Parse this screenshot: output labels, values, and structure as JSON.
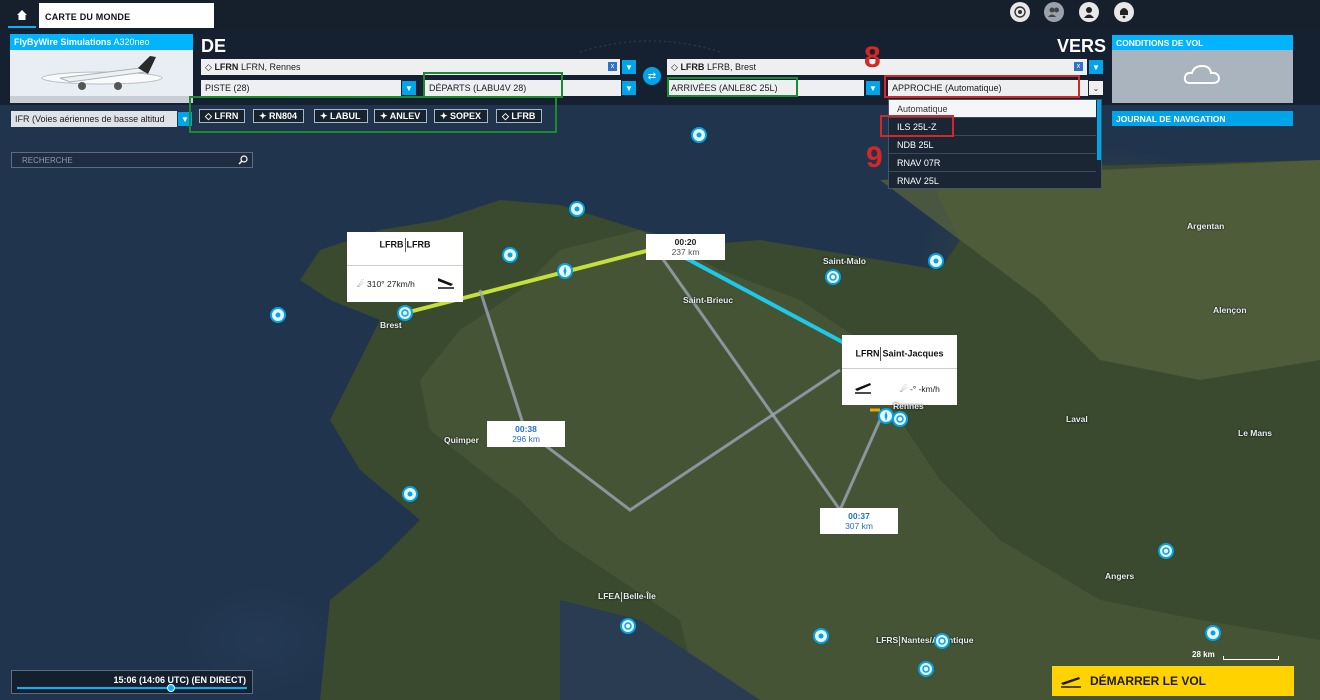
{
  "topbar": {
    "home_icon": "home-icon",
    "world_tab": "CARTE DU MONDE",
    "icons": [
      "radar-icon",
      "friends-icon",
      "profile-icon",
      "notification-icon"
    ]
  },
  "aircraft": {
    "brand": "FlyByWire Simulations",
    "model": "A320neo"
  },
  "from": {
    "label": "DE",
    "airport_code": "LFRN",
    "airport_name": "LFRN, Rennes",
    "runway": "PISTE (28)",
    "departure": "DÉPARTS (LABU4V 28)"
  },
  "to": {
    "label": "VERS",
    "airport_code": "LFRB",
    "airport_name": "LFRB, Brest",
    "arrival": "ARRIVÉES (ANLE8C 25L)",
    "approach": "APPROCHE (Automatique)"
  },
  "weather": {
    "title": "CONDITIONS DE VOL",
    "icon": "cloud-icon"
  },
  "nav_log": {
    "title": "JOURNAL DE NAVIGATION"
  },
  "flight_type": "IFR (Voies aériennes de basse altitud",
  "waypoints": [
    "LFRN",
    "RN804",
    "LABUL",
    "ANLEV",
    "SOPEX",
    "LFRB"
  ],
  "approach_options": [
    "Automatique",
    "ILS 25L-Z",
    "NDB 25L",
    "RNAV 07R",
    "RNAV 25L"
  ],
  "annotations": {
    "step8": "8",
    "step9": "9"
  },
  "search": {
    "placeholder": "RECHERCHE"
  },
  "info_boxes": {
    "brest": {
      "code": "LFRB",
      "name": "LFRB",
      "wind": "310° 27km/h"
    },
    "rennes": {
      "code": "LFRN",
      "name": "Saint-Jacques",
      "wind": "-° -km/h"
    }
  },
  "legs": [
    {
      "time": "00:20",
      "distance": "237 km"
    },
    {
      "time": "00:38",
      "distance": "296 km"
    },
    {
      "time": "00:37",
      "distance": "307 km"
    }
  ],
  "cities": {
    "brest": "Brest",
    "saint_malo": "Saint-Malo",
    "saint_brieuc": "Saint-Brieuc",
    "argentan": "Argentan",
    "alencon": "Alençon",
    "laval": "Laval",
    "le_mans": "Le Mans",
    "quimper": "Quimper",
    "angers": "Angers",
    "rennes": "Rennes",
    "nantes_code": "LFRS",
    "nantes": "Nantes/Atlantique",
    "belle_ile_code": "LFEA",
    "belle_ile": "Belle-Île"
  },
  "time_bar": {
    "text": "15:06 (14:06 UTC) (EN DIRECT)",
    "progress": 0.67
  },
  "scale": {
    "label": "28 km"
  },
  "start_button": {
    "label": "DÉMARRER LE VOL",
    "icon": "takeoff-icon"
  },
  "colors": {
    "accent": "#00b4ff",
    "route_green": "#c5e03a",
    "route_blue": "#1ec8e8",
    "start_yellow": "#ffd200",
    "annotation_red": "#d42828",
    "annotation_green": "#1c8b2f"
  }
}
